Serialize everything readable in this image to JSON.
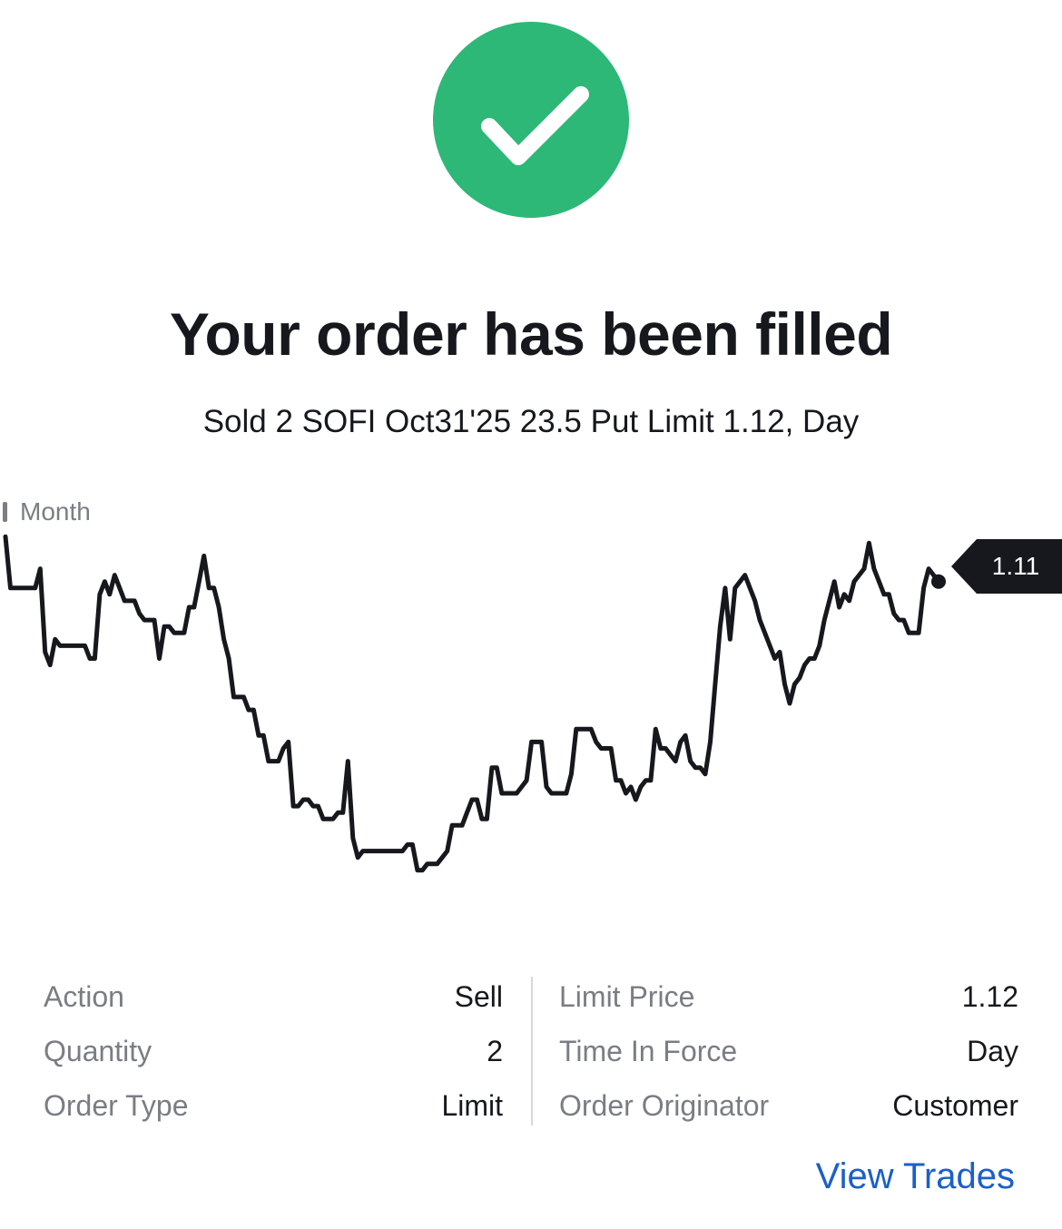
{
  "status": {
    "icon": "checkmark-icon",
    "success_color": "#2db877"
  },
  "header": {
    "title": "Your order has been filled",
    "summary": "Sold 2 SOFI Oct31'25 23.5 Put Limit 1.12, Day"
  },
  "chart_data": {
    "type": "line",
    "period_label": "Month",
    "last_price_label": "1.11",
    "line_color": "#16181d",
    "grid": false,
    "y": [
      1.4,
      1.32,
      1.32,
      1.32,
      1.32,
      1.32,
      1.32,
      1.35,
      1.22,
      1.2,
      1.24,
      1.23,
      1.23,
      1.23,
      1.23,
      1.23,
      1.23,
      1.21,
      1.21,
      1.31,
      1.33,
      1.31,
      1.34,
      1.32,
      1.3,
      1.3,
      1.3,
      1.28,
      1.27,
      1.27,
      1.27,
      1.21,
      1.26,
      1.26,
      1.25,
      1.25,
      1.25,
      1.29,
      1.29,
      1.33,
      1.37,
      1.32,
      1.32,
      1.29,
      1.24,
      1.21,
      1.15,
      1.15,
      1.15,
      1.13,
      1.13,
      1.09,
      1.09,
      1.05,
      1.05,
      1.05,
      1.07,
      1.08,
      0.98,
      0.98,
      0.99,
      0.99,
      0.98,
      0.98,
      0.96,
      0.96,
      0.96,
      0.97,
      0.97,
      1.05,
      0.93,
      0.9,
      0.91,
      0.91,
      0.91,
      0.91,
      0.91,
      0.91,
      0.91,
      0.91,
      0.91,
      0.92,
      0.92,
      0.88,
      0.88,
      0.89,
      0.89,
      0.89,
      0.9,
      0.91,
      0.95,
      0.95,
      0.95,
      0.97,
      0.99,
      0.99,
      0.96,
      0.96,
      1.04,
      1.04,
      1.0,
      1.0,
      1.0,
      1.0,
      1.01,
      1.02,
      1.08,
      1.08,
      1.08,
      1.01,
      1.0,
      1.0,
      1.0,
      1.0,
      1.03,
      1.1,
      1.1,
      1.1,
      1.1,
      1.08,
      1.07,
      1.07,
      1.07,
      1.02,
      1.02,
      1.0,
      1.01,
      0.99,
      1.01,
      1.02,
      1.02,
      1.1,
      1.07,
      1.07,
      1.06,
      1.05,
      1.08,
      1.09,
      1.05,
      1.04,
      1.04,
      1.03,
      1.08,
      1.17,
      1.26,
      1.32,
      1.24,
      1.32,
      1.33,
      1.34,
      1.32,
      1.3,
      1.27,
      1.25,
      1.23,
      1.21,
      1.22,
      1.17,
      1.14,
      1.17,
      1.18,
      1.2,
      1.21,
      1.21,
      1.23,
      1.27,
      1.3,
      1.33,
      1.29,
      1.31,
      1.3,
      1.33,
      1.34,
      1.35,
      1.39,
      1.35,
      1.33,
      1.31,
      1.31,
      1.28,
      1.27,
      1.27,
      1.25,
      1.25,
      1.25,
      1.32,
      1.35,
      1.34,
      1.33
    ],
    "ylim": [
      0.85,
      1.43
    ]
  },
  "details": {
    "left": [
      {
        "label": "Action",
        "value": "Sell"
      },
      {
        "label": "Quantity",
        "value": "2"
      },
      {
        "label": "Order Type",
        "value": "Limit"
      }
    ],
    "right": [
      {
        "label": "Limit Price",
        "value": "1.12"
      },
      {
        "label": "Time In Force",
        "value": "Day"
      },
      {
        "label": "Order Originator",
        "value": "Customer"
      }
    ]
  },
  "actions": {
    "view_trades_label": "View Trades",
    "link_color": "#1b5fc9"
  }
}
